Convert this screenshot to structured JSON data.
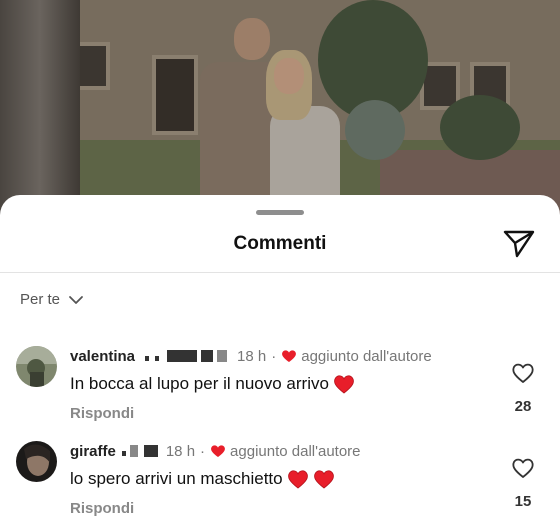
{
  "sheet": {
    "title": "Commenti",
    "share_icon": "paper-plane-icon",
    "sort_label": "Per te",
    "sort_icon": "chevron-down-icon"
  },
  "colors": {
    "heart_red": "#e81e2a",
    "secondary_text": "#777777",
    "divider": "#e3e3e3"
  },
  "comments": [
    {
      "username": "valentina",
      "time": "18 h",
      "separator": "·",
      "author_note": "aggiunto dall'autore",
      "text": "In bocca al lupo per il nuovo arrivo",
      "emoji": [
        "red-heart"
      ],
      "reply_label": "Rispondi",
      "like_count": "28",
      "like_icon": "heart-outline-icon"
    },
    {
      "username": "giraffe",
      "time": "18 h",
      "separator": "·",
      "author_note": "aggiunto dall'autore",
      "text": "lo spero arrivi un maschietto",
      "emoji": [
        "red-heart",
        "red-heart"
      ],
      "reply_label": "Rispondi",
      "like_count": "15",
      "like_icon": "heart-outline-icon"
    }
  ]
}
